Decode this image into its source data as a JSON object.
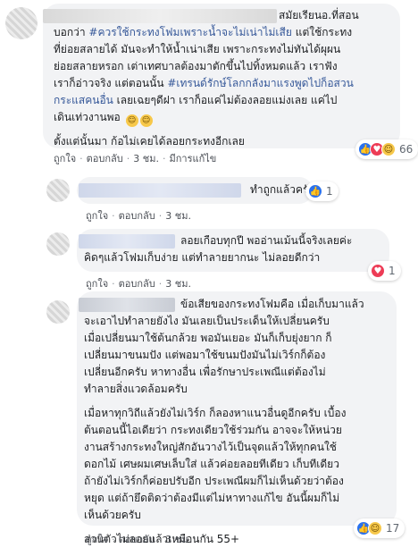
{
  "comment1": {
    "lines": [
      {
        "text": "สมัยเรียนอ.ที่สอน"
      },
      {
        "prefix": "บอกว่า ",
        "tag": "#ควรใช้กระทงโฟมเพราะน้ำจะไม่เน่าไม่เสีย",
        "suffix": " แต่ใช้กระทง"
      },
      {
        "text": "ที่ย่อยสลายได้ มันจะทำให้น้ำเน่าเสีย เพราะกระทงไม่ทันได้ผุผน"
      },
      {
        "text": "ย่อยสลายหรอก เต่าเทศบาลต้องมาตักขึ้นไปทิ้งหมดแล้ว เราฟัง"
      },
      {
        "prefix": "เราก็อ่าวจริง แต่ตอนนั้น ",
        "tag": "#เทรนด์รักษ์โลกกลังมาแรงพูดไปก็อสวน",
        "suffix": ""
      },
      {
        "prefix": "",
        "tag": "กระแสคนอื่น",
        "suffix": " เลยเฉยๆดีฝา เราก็อแค่ไม่ต้องลอยแม่งเลย แค่ไป"
      },
      {
        "text": "เดินเท่วงานพอ",
        "emoji": "😁😁"
      }
    ],
    "last_line": "ตั้งแต่นั้นมา ก้อไม่เคยได้ลอยกระทงอีกเลย",
    "reaction_count": "66",
    "actions": {
      "like": "ถูกใจ",
      "reply": "ตอบกลับ",
      "time": "3 ชม.",
      "edited": "มีการแก้ไข"
    }
  },
  "reply1": {
    "text": "ทำถูกแล้วครับ",
    "reaction_count": "1",
    "actions": {
      "like": "ถูกใจ",
      "reply": "ตอบกลับ",
      "time": "3 ชม."
    }
  },
  "reply2": {
    "lines": [
      "ลอยเกือบทุกปี พออ่านเม้นนี้จริงเลยค่ะ",
      "คิดๆแล้วโฟมเก็บง่าย แต่ทำลายยากนะ ไม่ลอยดีกว่า"
    ],
    "reaction_count": "1",
    "actions": {
      "like": "ถูกใจ",
      "reply": "ตอบกลับ",
      "time": "3 ชม."
    }
  },
  "reply3": {
    "first_line_tail": "ข้อเสียของกระทงโฟมคือ เมื่อเก็บมาแล้ว",
    "para1": [
      "จะเอาไปทำลายยังไง มันเลยเป็นประเด็นให้เปลี่ยนครับ",
      "เมื่อเปลี่ยนมาใช้ต้นกล้วย พอมันเยอะ มันก็เก็บยุ่งยาก ก็",
      "เปลี่ยนมาขนมปัง แต่พอมาใช้ขนมปังมันไม่เวิร์กก็ต้อง",
      "เปลี่ยนอีกครับ หาทางอื่น เพื่อรักษาประเพณีแต่ต้องไม่",
      "ทำลายสิ่งแวดล้อมครับ"
    ],
    "para2": [
      "เมื่อหาทุกวิถีแล้วยังไม่เวิร์ก ก็ลองหาแนวอื่นดูอีกครับ เบื้อง",
      "ต้นตอนนี้ไอเดียว่า กระทงเดียวใช้ร่วมกัน อาจจะให้หน่วย",
      "งานสร้างกระทงใหญ่สักอันวางไว้เป็นจุดแล้วให้ทุกคนใช้",
      "ดอกไม้ เศษผมเศษเล็บใส่ แล้วค่อยลอยทีเดียว เก็บทีเดียว",
      "ถ้ายังไม่เวิร์กก็ค่อยปรับอีก ประเพณีผมก็ไม่เห็นด้วยว่าต้อง",
      "หยุด แต่ถ้ายึดติดว่าต้องมีแต่ไม่หาทางแก้ไข อันนี้ผมก็ไม่",
      "เห็นด้วยครับ"
    ],
    "last_line": "ส่วนตัวไม่ลอยแล้วเหมือนกัน 55+",
    "reaction_count": "17",
    "actions": {
      "like": "ถูกใจ",
      "reply": "ตอบกลับ",
      "time": "3 ชม."
    }
  },
  "colors": {
    "link": "#365899",
    "bubble": "#f2f3f5",
    "meta": "#606770"
  }
}
